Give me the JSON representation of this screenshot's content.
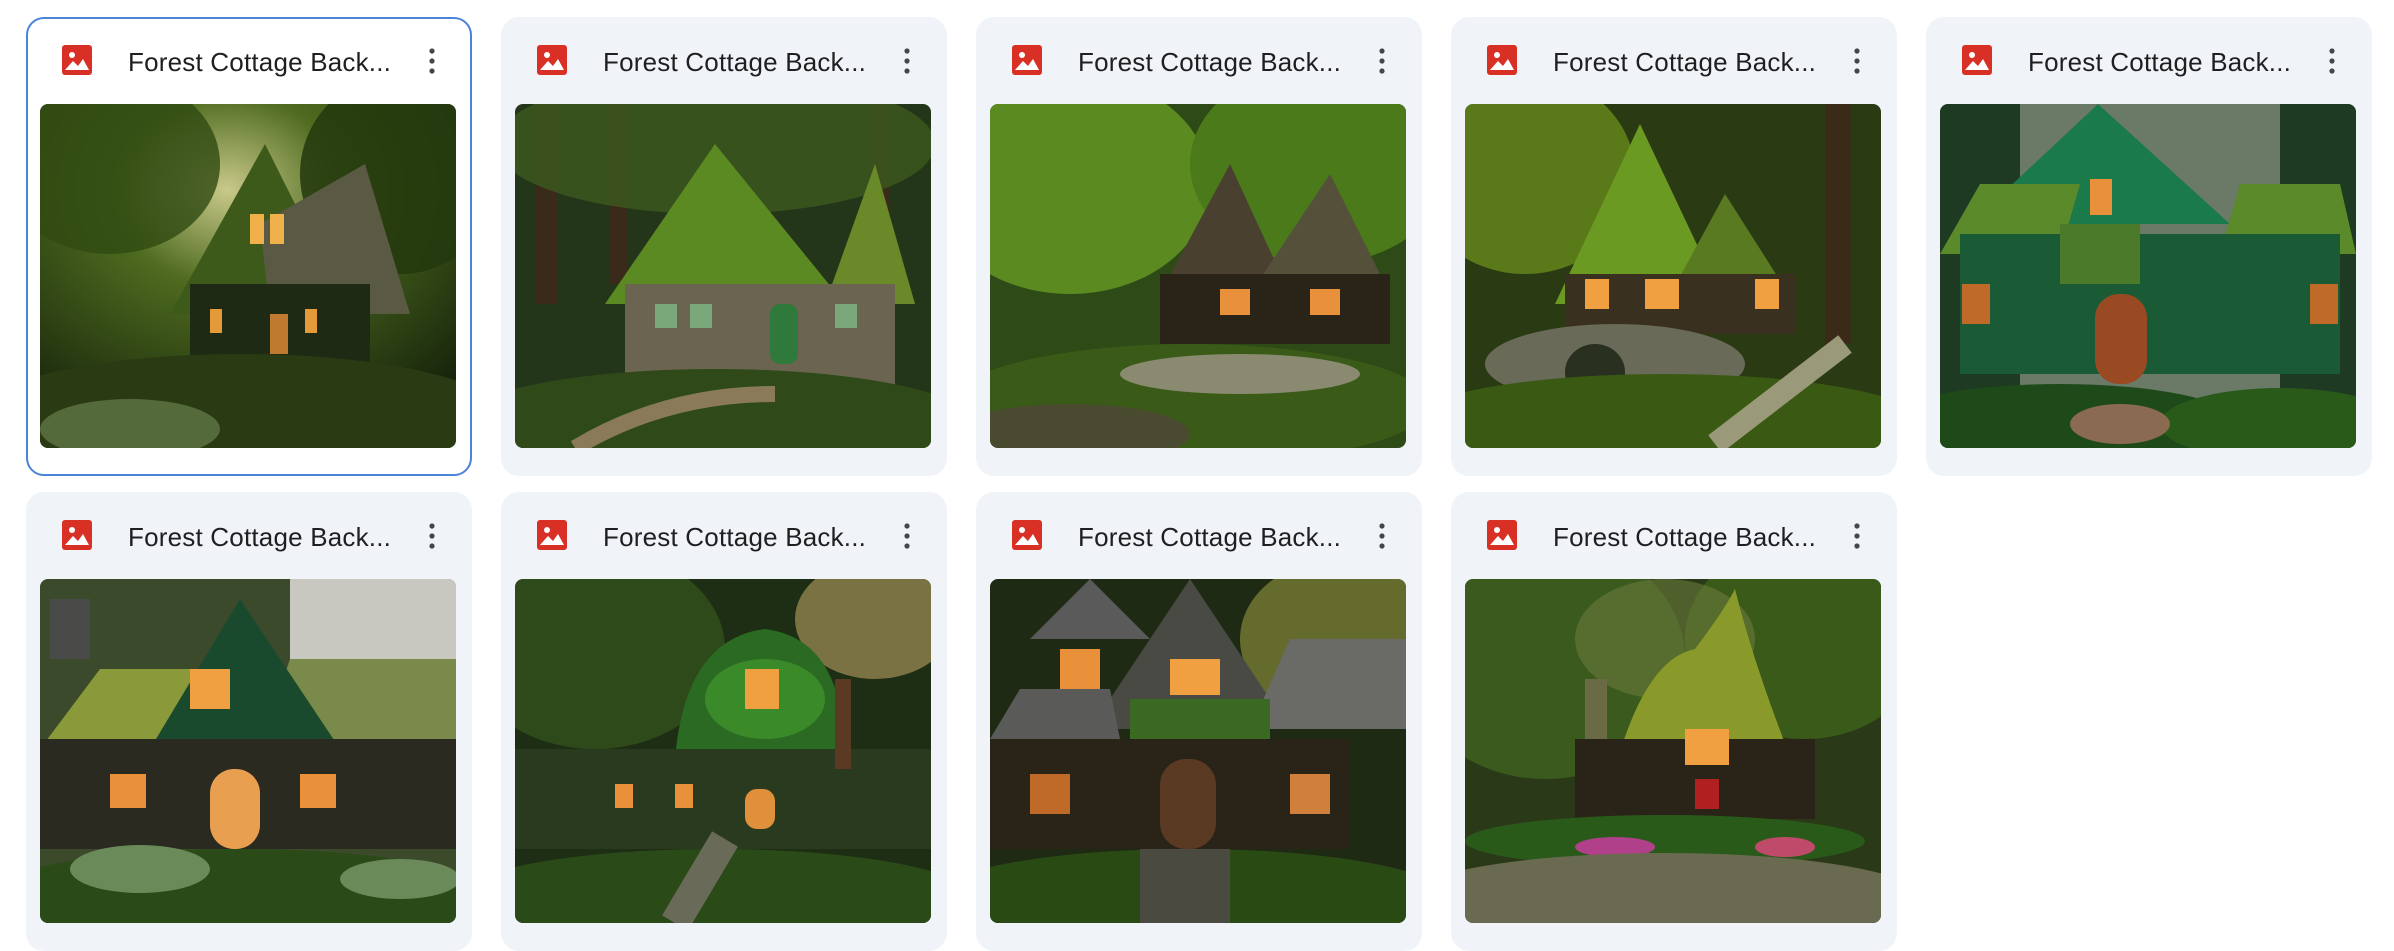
{
  "files": [
    {
      "title": "Forest Cottage Back...",
      "type_icon": "image-file-icon",
      "selected": true,
      "thumbnail": "forest-cottage-image"
    },
    {
      "title": "Forest Cottage Back...",
      "type_icon": "image-file-icon",
      "selected": false,
      "thumbnail": "forest-cottage-image"
    },
    {
      "title": "Forest Cottage Back...",
      "type_icon": "image-file-icon",
      "selected": false,
      "thumbnail": "forest-cottage-image"
    },
    {
      "title": "Forest Cottage Back...",
      "type_icon": "image-file-icon",
      "selected": false,
      "thumbnail": "forest-cottage-image"
    },
    {
      "title": "Forest Cottage Back...",
      "type_icon": "image-file-icon",
      "selected": false,
      "thumbnail": "forest-cottage-image"
    },
    {
      "title": "Forest Cottage Back...",
      "type_icon": "image-file-icon",
      "selected": false,
      "thumbnail": "forest-cottage-image"
    },
    {
      "title": "Forest Cottage Back...",
      "type_icon": "image-file-icon",
      "selected": false,
      "thumbnail": "forest-cottage-image"
    },
    {
      "title": "Forest Cottage Back...",
      "type_icon": "image-file-icon",
      "selected": false,
      "thumbnail": "forest-cottage-image"
    },
    {
      "title": "Forest Cottage Back...",
      "type_icon": "image-file-icon",
      "selected": false,
      "thumbnail": "forest-cottage-image"
    }
  ],
  "colors": {
    "card_bg": "#f0f4f9",
    "selected_border": "#4a83d8",
    "image_icon": "#d93025",
    "title_text": "#1f1f1f"
  }
}
